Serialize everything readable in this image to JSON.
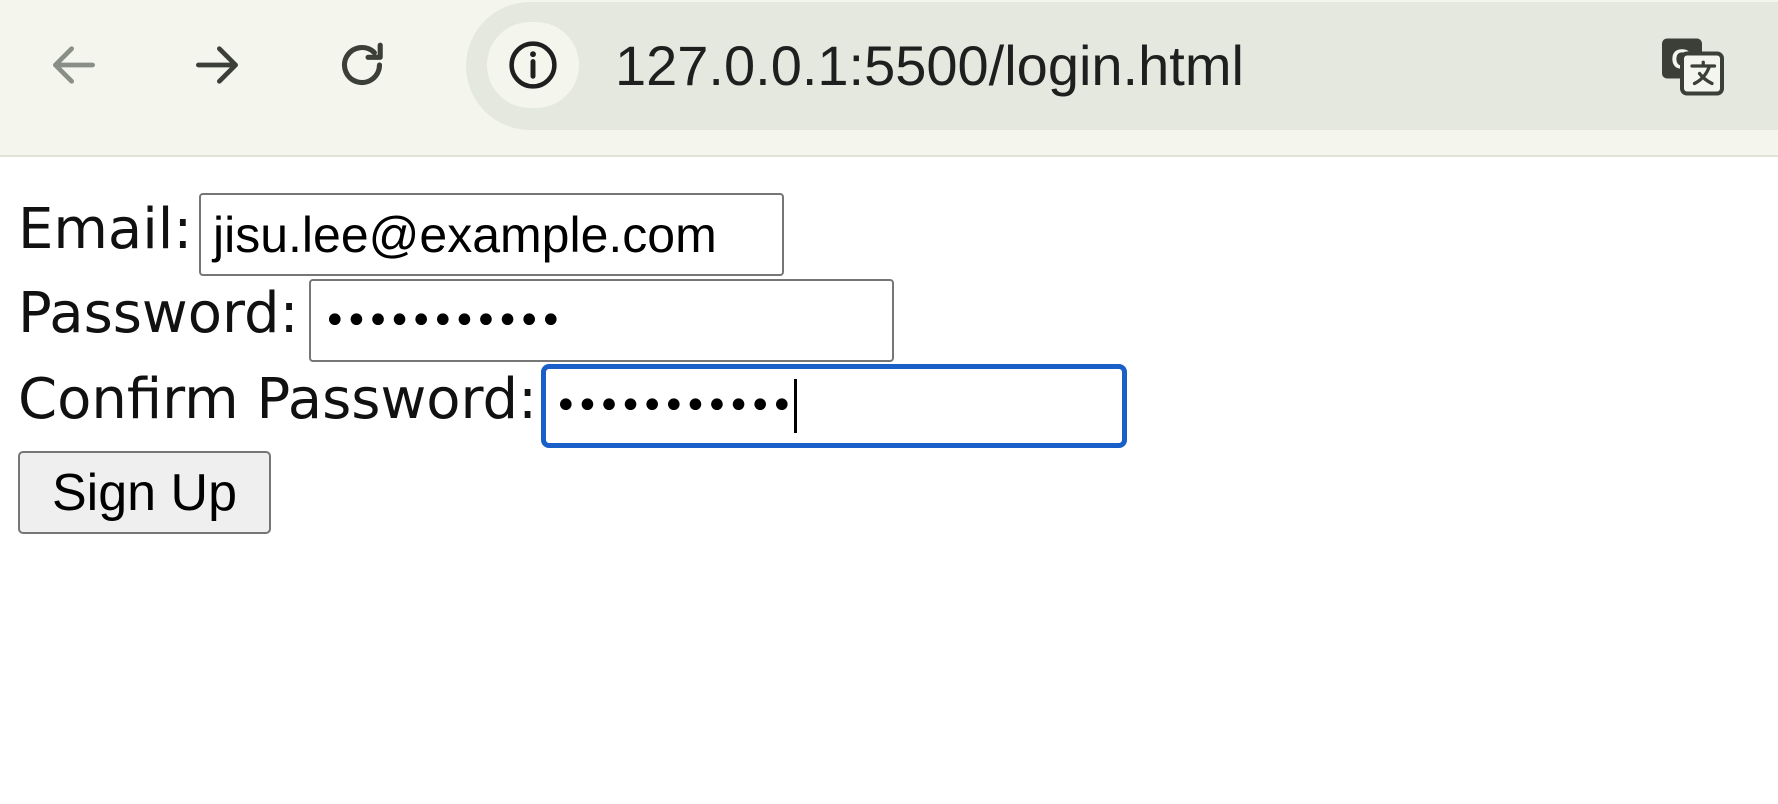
{
  "browser": {
    "url": "127.0.0.1:5500/login.html",
    "icons": {
      "back": "arrow-left-icon",
      "forward": "arrow-right-icon",
      "reload": "reload-icon",
      "site_info": "info-circle-icon",
      "translate": "translate-icon"
    }
  },
  "form": {
    "email_label": "Email:",
    "email_value": "jisu.lee@example.com",
    "password_label": "Password:",
    "password_mask": "•••••••••••",
    "confirm_label": "Confirm Password:",
    "confirm_mask": "•••••••••••",
    "submit_label": "Sign Up"
  },
  "colors": {
    "focus_ring": "#1a5fc7",
    "toolbar_bg": "#f4f6ee",
    "omnibox_bg": "#e5e8de"
  }
}
